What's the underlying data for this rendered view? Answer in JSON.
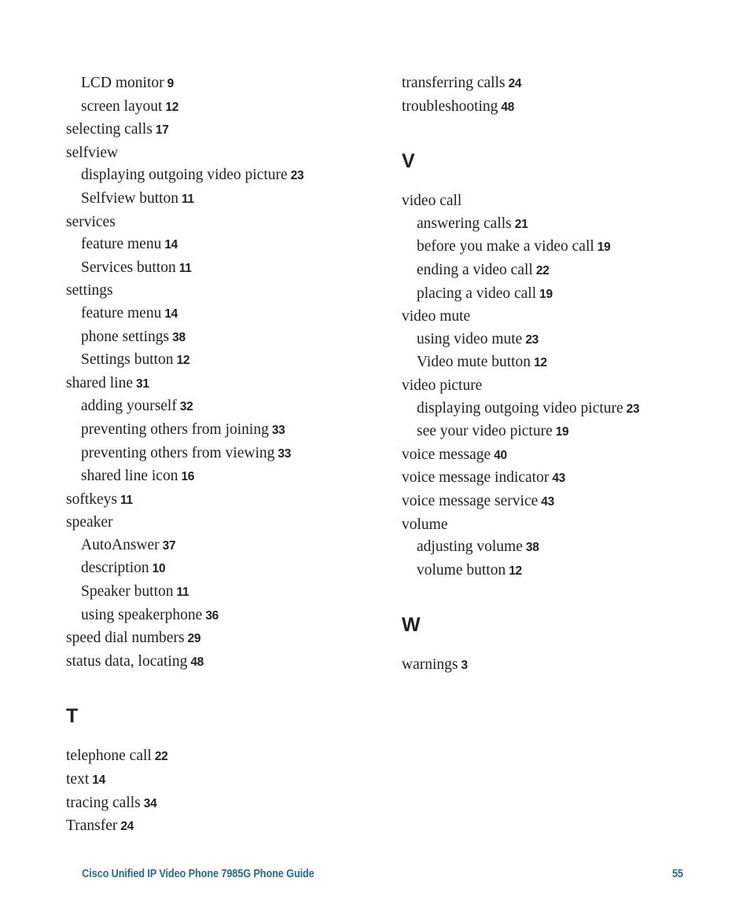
{
  "page": {
    "type": "book-index-page",
    "footer": {
      "title": "Cisco Unified IP Video Phone 7985G Phone Guide",
      "page_number": "55"
    },
    "text_color": "#231f20",
    "footer_color": "#256b8a"
  },
  "columns": [
    {
      "name": "left-column",
      "sections": [
        {
          "letter": null,
          "spaced": false,
          "entries": [
            {
              "label": "LCD monitor",
              "page": "9",
              "level": 1
            },
            {
              "label": "screen layout",
              "page": "12",
              "level": 1
            },
            {
              "label": "selecting calls",
              "page": "17",
              "level": 0
            },
            {
              "label": "selfview",
              "page": "",
              "level": 0
            },
            {
              "label": "displaying outgoing video picture",
              "page": "23",
              "level": 1
            },
            {
              "label": "Selfview button",
              "page": "11",
              "level": 1
            },
            {
              "label": "services",
              "page": "",
              "level": 0
            },
            {
              "label": "feature menu",
              "page": "14",
              "level": 1
            },
            {
              "label": "Services button",
              "page": "11",
              "level": 1
            },
            {
              "label": "settings",
              "page": "",
              "level": 0
            },
            {
              "label": "feature menu",
              "page": "14",
              "level": 1
            },
            {
              "label": "phone settings",
              "page": "38",
              "level": 1
            },
            {
              "label": "Settings button",
              "page": "12",
              "level": 1
            },
            {
              "label": "shared line",
              "page": "31",
              "level": 0
            },
            {
              "label": "adding yourself",
              "page": "32",
              "level": 1
            },
            {
              "label": "preventing others from joining",
              "page": "33",
              "level": 1
            },
            {
              "label": "preventing others from viewing",
              "page": "33",
              "level": 1
            },
            {
              "label": "shared line icon",
              "page": "16",
              "level": 1
            },
            {
              "label": "softkeys",
              "page": "11",
              "level": 0
            },
            {
              "label": "speaker",
              "page": "",
              "level": 0
            },
            {
              "label": "AutoAnswer",
              "page": "37",
              "level": 1
            },
            {
              "label": "description",
              "page": "10",
              "level": 1
            },
            {
              "label": "Speaker button",
              "page": "11",
              "level": 1
            },
            {
              "label": "using speakerphone",
              "page": "36",
              "level": 1
            },
            {
              "label": "speed dial numbers",
              "page": "29",
              "level": 0
            },
            {
              "label": "status data, locating",
              "page": "48",
              "level": 0
            }
          ]
        },
        {
          "letter": "T",
          "spaced": true,
          "entries": [
            {
              "label": "telephone call",
              "page": "22",
              "level": 0
            },
            {
              "label": "text",
              "page": "14",
              "level": 0
            },
            {
              "label": "tracing calls",
              "page": "34",
              "level": 0
            },
            {
              "label": "Transfer",
              "page": "24",
              "level": 0
            }
          ]
        }
      ]
    },
    {
      "name": "right-column",
      "sections": [
        {
          "letter": null,
          "spaced": false,
          "entries": [
            {
              "label": "transferring calls",
              "page": "24",
              "level": 0
            },
            {
              "label": "troubleshooting",
              "page": "48",
              "level": 0
            }
          ]
        },
        {
          "letter": "V",
          "spaced": true,
          "entries": [
            {
              "label": "video call",
              "page": "",
              "level": 0
            },
            {
              "label": "answering calls",
              "page": "21",
              "level": 1
            },
            {
              "label": "before you make a video call",
              "page": "19",
              "level": 1
            },
            {
              "label": "ending a video call",
              "page": "22",
              "level": 1
            },
            {
              "label": "placing a video call",
              "page": "19",
              "level": 1
            },
            {
              "label": "video mute",
              "page": "",
              "level": 0
            },
            {
              "label": "using video mute",
              "page": "23",
              "level": 1
            },
            {
              "label": "Video mute button",
              "page": "12",
              "level": 1
            },
            {
              "label": "video picture",
              "page": "",
              "level": 0
            },
            {
              "label": "displaying outgoing video picture",
              "page": "23",
              "level": 1
            },
            {
              "label": "see your video picture",
              "page": "19",
              "level": 1
            },
            {
              "label": "voice message",
              "page": "40",
              "level": 0
            },
            {
              "label": "voice message indicator",
              "page": "43",
              "level": 0
            },
            {
              "label": "voice message service",
              "page": "43",
              "level": 0
            },
            {
              "label": "volume",
              "page": "",
              "level": 0
            },
            {
              "label": "adjusting volume",
              "page": "38",
              "level": 1
            },
            {
              "label": "volume button",
              "page": "12",
              "level": 1
            }
          ]
        },
        {
          "letter": "W",
          "spaced": true,
          "entries": [
            {
              "label": "warnings",
              "page": "3",
              "level": 0
            }
          ]
        }
      ]
    }
  ]
}
